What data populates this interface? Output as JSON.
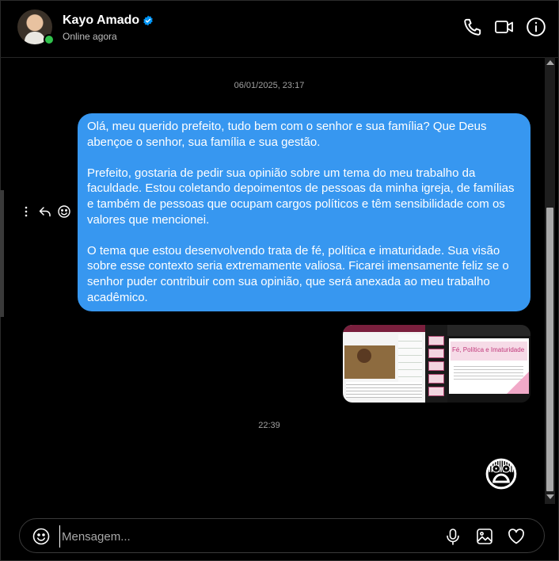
{
  "header": {
    "name": "Kayo Amado",
    "status": "Online agora",
    "verified": true,
    "icons": [
      "phone-icon",
      "video-camera-icon",
      "info-icon"
    ]
  },
  "thread": {
    "timestamp_1": "06/01/2025, 23:17",
    "message": {
      "paragraphs": [
        "Olá, meu querido prefeito, tudo bem com o senhor e sua família? Que Deus abençoe o senhor, sua família e sua gestão.",
        "Prefeito, gostaria de pedir sua opinião sobre um tema do meu trabalho da faculdade. Estou coletando depoimentos de pessoas da minha igreja, de famílias e também de pessoas que ocupam cargos políticos e têm sensibilidade com os valores que mencionei.",
        "O tema que estou desenvolvendo trata de fé, política e imaturidade. Sua visão sobre esse contexto seria extremamente valiosa. Ficarei imensamente feliz se o senhor puder contribuir com sua opinião, que será anexada ao meu trabalho acadêmico."
      ]
    },
    "attachment": {
      "slide_title": "Fé, Política e Imaturidade"
    },
    "timestamp_2": "22:39",
    "reaction_emoji": "😨"
  },
  "composer": {
    "placeholder": "Mensagem..."
  },
  "colors": {
    "bubble": "#3797f0",
    "online": "#31c24d",
    "verified": "#0095f6"
  }
}
